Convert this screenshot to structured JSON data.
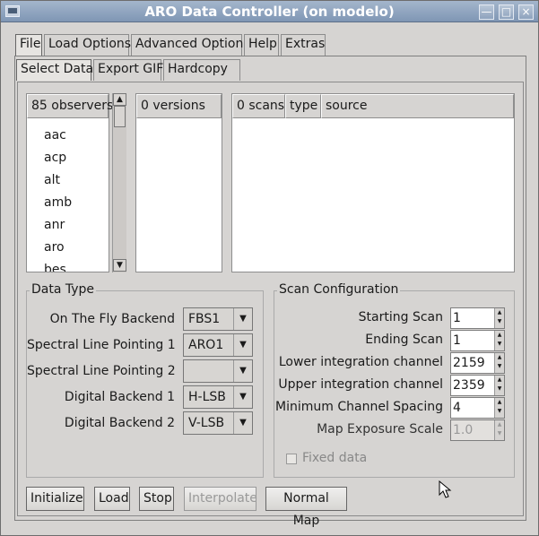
{
  "window": {
    "title": "ARO Data Controller (on modelo)",
    "icons": [
      "app-menu-icon",
      "minimize-icon",
      "maximize-icon",
      "close-icon"
    ]
  },
  "main_tabs": [
    "File",
    "Load Options",
    "Advanced Options",
    "Help",
    "Extras"
  ],
  "sub_tabs": [
    "Select Data",
    "Export GIF",
    "Hardcopy"
  ],
  "observers": {
    "header": "85 observers",
    "items": [
      "aac",
      "acp",
      "alt",
      "amb",
      "anr",
      "aro",
      "bes"
    ]
  },
  "versions": {
    "header": "0 versions"
  },
  "scans": {
    "headers": [
      "0 scans",
      "type",
      "source"
    ]
  },
  "data_type": {
    "title": "Data Type",
    "rows": [
      {
        "label": "On The Fly Backend",
        "value": "FBS1"
      },
      {
        "label": "Spectral Line Pointing 1",
        "value": "ARO1"
      },
      {
        "label": "Spectral Line Pointing 2",
        "value": ""
      },
      {
        "label": "Digital Backend 1",
        "value": "H-LSB"
      },
      {
        "label": "Digital Backend 2",
        "value": "V-LSB"
      }
    ]
  },
  "scan_config": {
    "title": "Scan Configuration",
    "rows": [
      {
        "label": "Starting Scan",
        "value": "1"
      },
      {
        "label": "Ending Scan",
        "value": "1"
      },
      {
        "label": "Lower integration channel",
        "value": "2159"
      },
      {
        "label": "Upper integration channel",
        "value": "2359"
      },
      {
        "label": "Minimum Channel Spacing",
        "value": "4"
      },
      {
        "label": "Map Exposure Scale",
        "value": "1.0"
      }
    ],
    "fixed_data": "Fixed data"
  },
  "buttons": [
    "Initialize",
    "Load",
    "Stop",
    "Interpolate",
    "Normal Map"
  ]
}
